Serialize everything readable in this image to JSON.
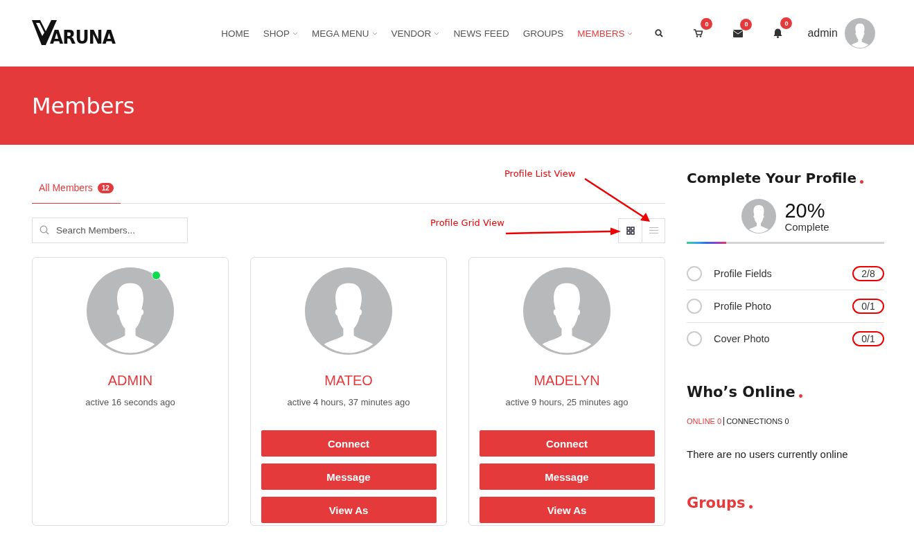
{
  "header": {
    "logo_text": "ARUNA",
    "nav": [
      {
        "label": "HOME",
        "selected": false,
        "dropdown": false
      },
      {
        "label": "SHOP",
        "selected": false,
        "dropdown": true
      },
      {
        "label": "MEGA MENU",
        "selected": false,
        "dropdown": true
      },
      {
        "label": "VENDOR",
        "selected": false,
        "dropdown": true
      },
      {
        "label": "NEWS FEED",
        "selected": false,
        "dropdown": false
      },
      {
        "label": "GROUPS",
        "selected": false,
        "dropdown": false
      },
      {
        "label": "MEMBERS",
        "selected": true,
        "dropdown": true
      }
    ],
    "icons": [
      {
        "kind": "search"
      },
      {
        "kind": "cart",
        "badge": "0"
      },
      {
        "kind": "mail",
        "badge": "0"
      },
      {
        "kind": "bell",
        "badge": "0"
      }
    ],
    "user": "admin"
  },
  "banner": {
    "title": "Members"
  },
  "tabs": [
    {
      "label": "All Members",
      "count": "12",
      "selected": true
    }
  ],
  "search": {
    "placeholder": "Search Members..."
  },
  "view_toggles": [
    {
      "kind": "grid",
      "selected": true
    },
    {
      "kind": "list",
      "selected": false
    }
  ],
  "annotations": {
    "list_view": "Profile List View",
    "grid_view": "Profile Grid View"
  },
  "members": [
    {
      "name": "ADMIN",
      "activity": "active 16 seconds ago",
      "online": true
    },
    {
      "name": "MATEO",
      "activity": "active 4 hours, 37 minutes ago",
      "online": false,
      "actions": [
        "Connect",
        "Message",
        "View As"
      ]
    },
    {
      "name": "MADELYN",
      "activity": "active 9 hours, 25 minutes ago",
      "online": false,
      "actions": [
        "Connect",
        "Message",
        "View As"
      ]
    }
  ],
  "profile_widget": {
    "title": "Complete Your Profile",
    "percent": "20%",
    "label": "Complete",
    "level": 0.2,
    "items": [
      {
        "label": "Profile Fields",
        "count": "2/8",
        "checked": false
      },
      {
        "label": "Profile Photo",
        "count": "0/1",
        "checked": false
      },
      {
        "label": "Cover Photo",
        "count": "0/1",
        "checked": false
      }
    ]
  },
  "online_widget": {
    "title": "Who’s Online",
    "tabs": [
      {
        "label": "ONLINE 0",
        "selected": true
      },
      {
        "label": "CONNECTIONS 0",
        "selected": false
      }
    ],
    "message": "There are no users currently online"
  },
  "groups_widget": {
    "title": "Groups"
  }
}
